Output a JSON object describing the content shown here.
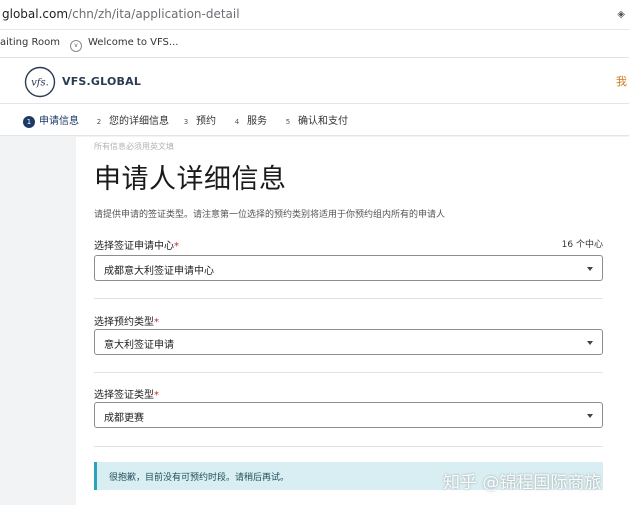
{
  "browser": {
    "url_host": "global.com",
    "url_path": "/chn/zh/ita/application-detail",
    "bookmarks": [
      {
        "label": "aiting Room"
      },
      {
        "label": "Welcome to VFS..."
      }
    ]
  },
  "header": {
    "logo_text": "VFS.GLOBAL",
    "emblem_text": "vfs.",
    "lang_fragment": "我"
  },
  "steps": [
    {
      "num": "1",
      "label": "申请信息",
      "active": true
    },
    {
      "num": "2",
      "label": "您的详细信息",
      "active": false
    },
    {
      "num": "3",
      "label": "预约",
      "active": false
    },
    {
      "num": "4",
      "label": "服务",
      "active": false
    },
    {
      "num": "5",
      "label": "确认和支付",
      "active": false
    }
  ],
  "form": {
    "subnote": "所有信息必须用英文填",
    "title": "申请人详细信息",
    "description": "请提供申请的签证类型。请注意第一位选择的预约类别将适用于你预约组内所有的申请人",
    "center_count": "16 个中心",
    "fields": [
      {
        "label": "选择签证申请中心",
        "required_mark": "*",
        "value": "成都意大利签证申请中心"
      },
      {
        "label": "选择预约类型",
        "required_mark": "*",
        "value": "意大利签证申请"
      },
      {
        "label": "选择签证类型",
        "required_mark": "*",
        "value": "成都更赛"
      }
    ],
    "alert": "很抱歉，目前没有可预约时段。请稍后再试。"
  },
  "watermark": "知乎 @锦程国际商旅",
  "colors": {
    "brand_navy": "#1d3a66",
    "alert_bg": "#d9eef2",
    "alert_border": "#2aa4b8",
    "required": "#c42b2b"
  }
}
